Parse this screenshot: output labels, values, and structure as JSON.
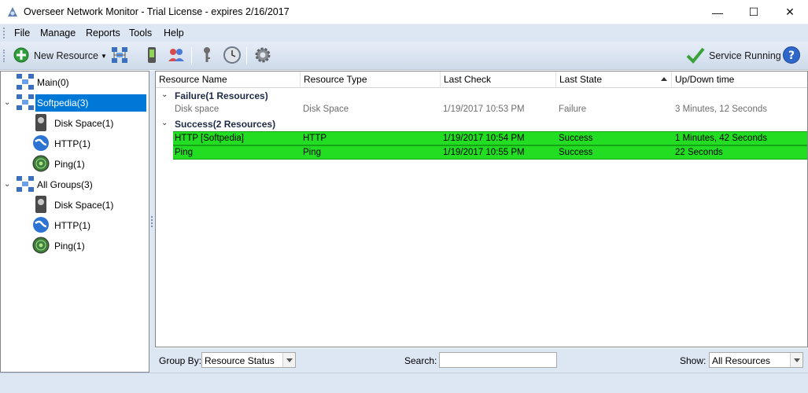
{
  "window": {
    "title": "Overseer Network Monitor - Trial License - expires 2/16/2017",
    "minimize": "—",
    "maximize": "☐",
    "close": "✕"
  },
  "menu": [
    "File",
    "Manage",
    "Reports",
    "Tools",
    "Help"
  ],
  "toolbar": {
    "new_resource": "New Resource",
    "service_status": "Service Running"
  },
  "tree": {
    "main": "Main(0)",
    "softpedia": {
      "label": "Softpedia(3)",
      "children": [
        "Disk Space(1)",
        "HTTP(1)",
        "Ping(1)"
      ]
    },
    "all_groups": {
      "label": "All Groups(3)",
      "children": [
        "Disk Space(1)",
        "HTTP(1)",
        "Ping(1)"
      ]
    }
  },
  "grid": {
    "columns": [
      "Resource Name",
      "Resource Type",
      "Last Check",
      "Last State",
      "Up/Down time"
    ],
    "groups": [
      {
        "title": "Failure(1 Resources)",
        "rows": [
          [
            "Disk space",
            "Disk Space",
            "1/19/2017 10:53 PM",
            "Failure",
            "3 Minutes, 12 Seconds"
          ]
        ]
      },
      {
        "title": "Success(2 Resources)",
        "rows": [
          [
            "HTTP [Softpedia]",
            "HTTP",
            "1/19/2017 10:54 PM",
            "Success",
            "1 Minutes, 42 Seconds"
          ],
          [
            "Ping",
            "Ping",
            "1/19/2017 10:55 PM",
            "Success",
            "22 Seconds"
          ]
        ]
      }
    ]
  },
  "bottom": {
    "group_by_label": "Group By:",
    "group_by_value": "Resource Status",
    "search_label": "Search:",
    "search_value": "",
    "show_label": "Show:",
    "show_value": "All Resources"
  },
  "colors": {
    "success_row": "#22dd22",
    "selection": "#0078d7",
    "chrome": "#dde6f3"
  }
}
